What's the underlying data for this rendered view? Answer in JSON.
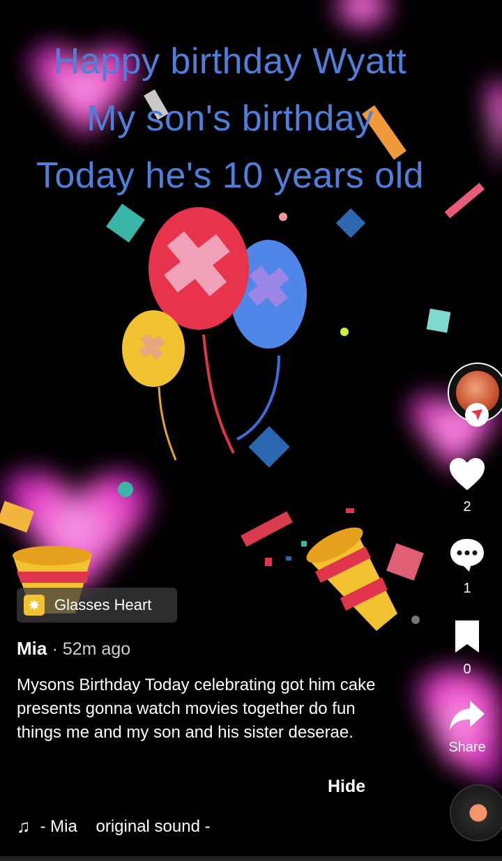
{
  "overlay": {
    "line1": "Happy birthday Wyatt",
    "line2": "My son's birthday",
    "line3": "Today he's 10 years old"
  },
  "effect": {
    "icon": "sparkle-icon",
    "label": "Glasses Heart"
  },
  "post": {
    "author": "Mia",
    "time": "· 52m ago",
    "caption": "Mysons Birthday Today celebrating got him cake presents gonna watch movies together do fun things me and my son and his sister deserae.",
    "hide_label": "Hide"
  },
  "sound": {
    "icon": "music-note-icon",
    "text": "- Mia    original sound -"
  },
  "actions": {
    "likes": "2",
    "comments": "1",
    "saves": "0",
    "share_label": "Share"
  },
  "colors": {
    "overlay_text": "#4f7fd8",
    "like": "#ffffff",
    "follow_badge": "#e8304a",
    "heart_glow": "#ff4fd8"
  }
}
